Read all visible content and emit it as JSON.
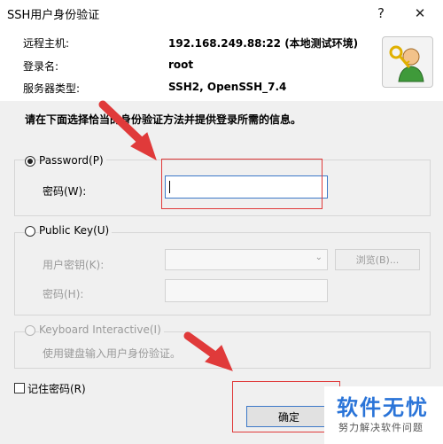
{
  "window": {
    "title": "SSH用户身份验证",
    "help_glyph": "?",
    "close_glyph": "✕"
  },
  "info": {
    "host_label": "远程主机:",
    "host_value": "192.168.249.88:22 (本地测试环境)",
    "login_label": "登录名:",
    "login_value": "root",
    "server_label": "服务器类型:",
    "server_value": "SSH2, OpenSSH_7.4"
  },
  "instruction": "请在下面选择恰当的身份验证方法并提供登录所需的信息。",
  "password_group": {
    "radio_label": "Password(P)",
    "field_label": "密码(W):",
    "field_value": ""
  },
  "public_key_group": {
    "radio_label": "Public Key(U)",
    "key_label": "用户密钥(K):",
    "key_value": "",
    "browse_label": "浏览(B)...",
    "passphrase_label": "密码(H):",
    "passphrase_value": ""
  },
  "keyboard_group": {
    "radio_label": "Keyboard Interactive(I)",
    "description": "使用键盘输入用户身份验证。"
  },
  "remember": {
    "label": "记住密码(R)"
  },
  "ok_button": {
    "label": "确定"
  },
  "watermark": {
    "title": "软件无忧",
    "subtitle": "努力解决软件问题"
  },
  "colors": {
    "annotation_red": "#e03a3a",
    "focus_blue": "#3c78c8",
    "watermark_blue": "#2a74d8"
  }
}
